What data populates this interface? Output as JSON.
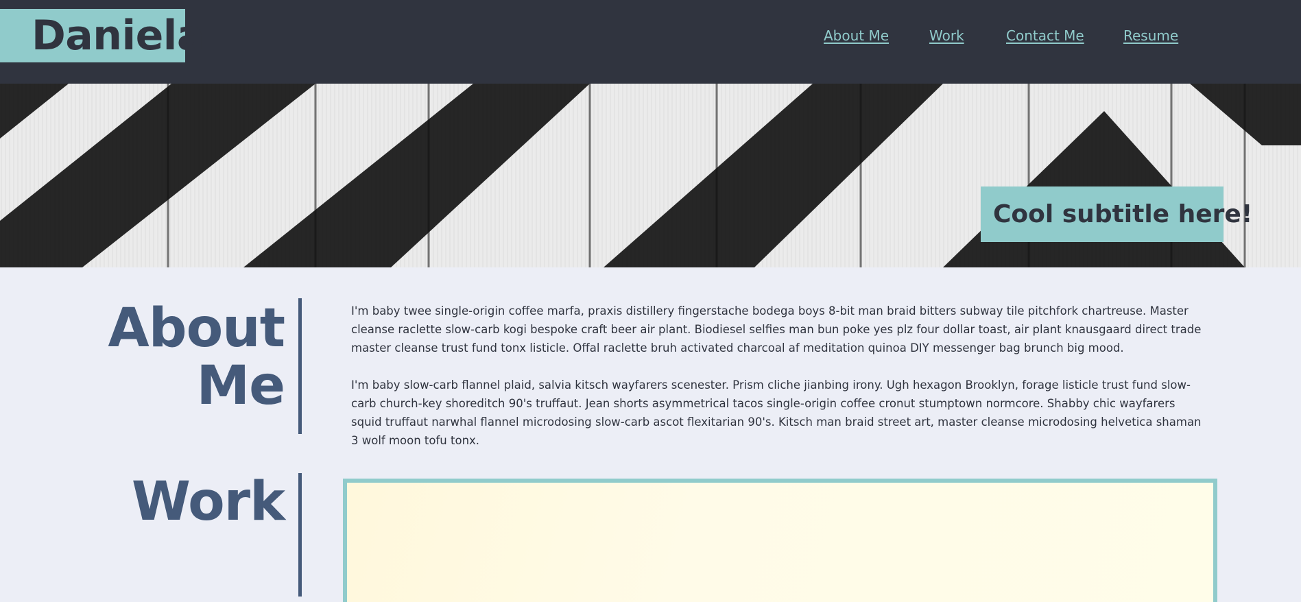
{
  "header": {
    "logo": "Daniela",
    "nav": [
      "About Me",
      "Work",
      "Contact Me",
      "Resume"
    ]
  },
  "hero": {
    "subtitle": "Cool subtitle here!"
  },
  "about": {
    "heading_line1": "About",
    "heading_line2": "Me",
    "paragraphs": [
      "I'm baby twee single-origin coffee marfa, praxis distillery fingerstache bodega boys 8-bit man braid bitters subway tile pitchfork chartreuse. Master cleanse raclette slow-carb kogi bespoke craft beer air plant. Biodiesel selfies man bun poke yes plz four dollar toast, air plant knausgaard direct trade master cleanse trust fund tonx listicle. Offal raclette bruh activated charcoal af meditation quinoa DIY messenger bag brunch big mood.",
      "I'm baby slow-carb flannel plaid, salvia kitsch wayfarers scenester. Prism cliche jianbing irony. Ugh hexagon Brooklyn, forage listicle trust fund slow-carb church-key shoreditch 90's truffaut. Jean shorts asymmetrical tacos single-origin coffee cronut stumptown normcore. Shabby chic wayfarers squid truffaut narwhal flannel microdosing slow-carb ascot flexitarian 90's. Kitsch man braid street art, master cleanse microdosing helvetica shaman 3 wolf moon tofu tonx."
    ]
  },
  "work": {
    "heading": "Work"
  },
  "colors": {
    "header_bg": "#30343f",
    "accent": "#90cbcb",
    "page_bg": "#eceef6",
    "heading": "#455a7a"
  }
}
